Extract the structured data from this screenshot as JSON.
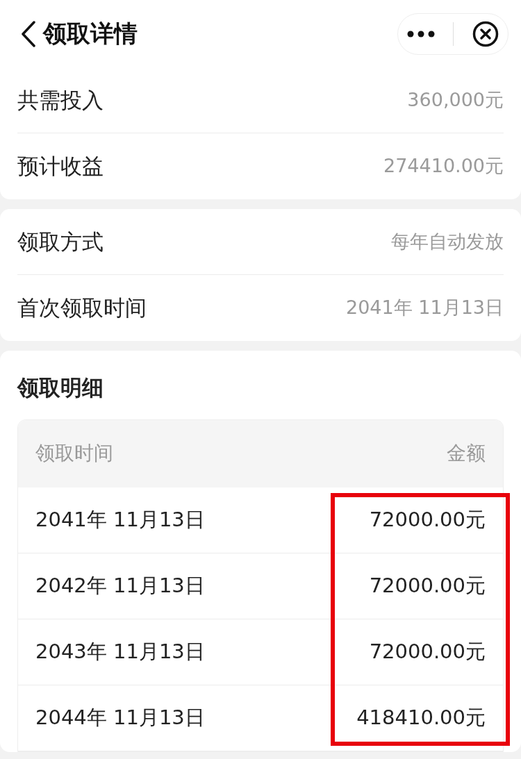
{
  "header": {
    "title": "领取详情"
  },
  "summary": [
    {
      "label": "共需投入",
      "value": "360,000元"
    },
    {
      "label": "预计收益",
      "value": "274410.00元"
    }
  ],
  "method": [
    {
      "label": "领取方式",
      "value": "每年自动发放"
    },
    {
      "label": "首次领取时间",
      "value": "2041年 11月13日"
    }
  ],
  "details": {
    "title": "领取明细",
    "columns": [
      "领取时间",
      "金额"
    ],
    "rows": [
      {
        "date": "2041年 11月13日",
        "amount": "72000.00元"
      },
      {
        "date": "2042年 11月13日",
        "amount": "72000.00元"
      },
      {
        "date": "2043年 11月13日",
        "amount": "72000.00元"
      },
      {
        "date": "2044年 11月13日",
        "amount": "418410.00元"
      }
    ],
    "amounts_highlighted": true
  }
}
